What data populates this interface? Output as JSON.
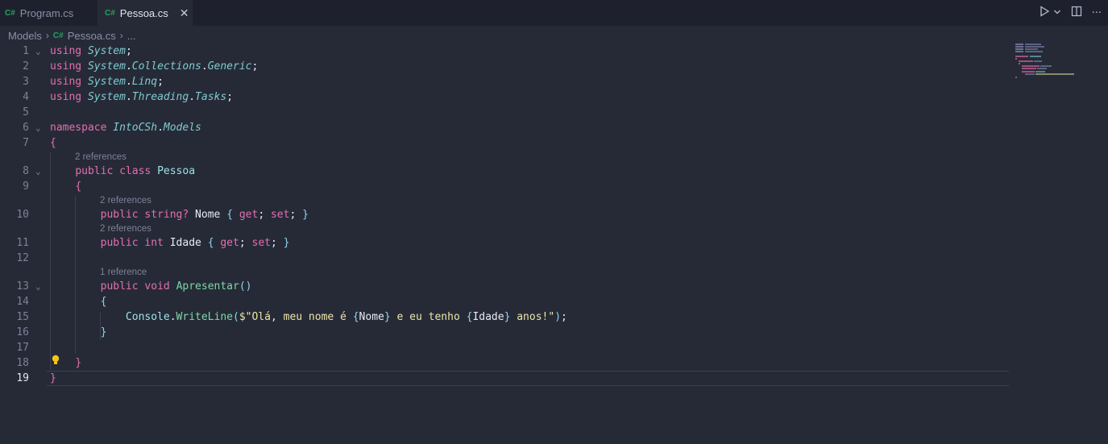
{
  "tabs": [
    {
      "icon": "C#",
      "label": "Program.cs",
      "active": false
    },
    {
      "icon": "C#",
      "label": "Pessoa.cs",
      "active": true
    }
  ],
  "breadcrumb": {
    "folder": "Models",
    "file_icon": "C#",
    "file": "Pessoa.cs",
    "more": "..."
  },
  "editor": {
    "active_line": 19,
    "code_lens": {
      "class_refs": "2 references",
      "nome_refs": "2 references",
      "idade_refs": "2 references",
      "apresentar_refs": "1 reference"
    },
    "lines": [
      {
        "n": "1",
        "tokens": [
          [
            "using ",
            "kw"
          ],
          [
            "System",
            "ns"
          ],
          [
            ";",
            "id"
          ]
        ]
      },
      {
        "n": "2",
        "tokens": [
          [
            "using ",
            "kw"
          ],
          [
            "System",
            "ns"
          ],
          [
            ".",
            "id"
          ],
          [
            "Collections",
            "ns"
          ],
          [
            ".",
            "id"
          ],
          [
            "Generic",
            "ns"
          ],
          [
            ";",
            "id"
          ]
        ]
      },
      {
        "n": "3",
        "tokens": [
          [
            "using ",
            "kw"
          ],
          [
            "System",
            "ns"
          ],
          [
            ".",
            "id"
          ],
          [
            "Linq",
            "ns"
          ],
          [
            ";",
            "id"
          ]
        ]
      },
      {
        "n": "4",
        "tokens": [
          [
            "using ",
            "kw"
          ],
          [
            "System",
            "ns"
          ],
          [
            ".",
            "id"
          ],
          [
            "Threading",
            "ns"
          ],
          [
            ".",
            "id"
          ],
          [
            "Tasks",
            "ns"
          ],
          [
            ";",
            "id"
          ]
        ]
      },
      {
        "n": "5",
        "tokens": []
      },
      {
        "n": "6",
        "tokens": [
          [
            "namespace ",
            "kw"
          ],
          [
            "IntoCSh",
            "ns"
          ],
          [
            ".",
            "id"
          ],
          [
            "Models",
            "ns"
          ]
        ]
      },
      {
        "n": "7",
        "tokens": [
          [
            "{",
            "br"
          ]
        ]
      },
      {
        "n": "8",
        "tokens": [
          [
            "    ",
            "id"
          ],
          [
            "public ",
            "kw"
          ],
          [
            "class ",
            "kw"
          ],
          [
            "Pessoa",
            "cls"
          ]
        ]
      },
      {
        "n": "9",
        "tokens": [
          [
            "    ",
            "id"
          ],
          [
            "{",
            "br"
          ]
        ]
      },
      {
        "n": "10",
        "tokens": [
          [
            "        ",
            "id"
          ],
          [
            "public ",
            "kw"
          ],
          [
            "string",
            "kw"
          ],
          [
            "? ",
            "kw"
          ],
          [
            "Nome ",
            "id"
          ],
          [
            "{ ",
            "br2"
          ],
          [
            "get",
            "kw"
          ],
          [
            "; ",
            "id"
          ],
          [
            "set",
            "kw"
          ],
          [
            "; ",
            "id"
          ],
          [
            "}",
            "br2"
          ]
        ]
      },
      {
        "n": "11",
        "tokens": [
          [
            "        ",
            "id"
          ],
          [
            "public ",
            "kw"
          ],
          [
            "int ",
            "kw"
          ],
          [
            "Idade ",
            "id"
          ],
          [
            "{ ",
            "br2"
          ],
          [
            "get",
            "kw"
          ],
          [
            "; ",
            "id"
          ],
          [
            "set",
            "kw"
          ],
          [
            "; ",
            "id"
          ],
          [
            "}",
            "br2"
          ]
        ]
      },
      {
        "n": "12",
        "tokens": []
      },
      {
        "n": "13",
        "tokens": [
          [
            "        ",
            "id"
          ],
          [
            "public ",
            "kw"
          ],
          [
            "void ",
            "kw"
          ],
          [
            "Apresentar",
            "fn"
          ],
          [
            "()",
            "br2"
          ]
        ]
      },
      {
        "n": "14",
        "tokens": [
          [
            "        ",
            "id"
          ],
          [
            "{",
            "br2"
          ]
        ]
      },
      {
        "n": "15",
        "tokens": [
          [
            "            ",
            "id"
          ],
          [
            "Console",
            "cls"
          ],
          [
            ".",
            "id"
          ],
          [
            "WriteLine",
            "fn"
          ],
          [
            "(",
            "br2"
          ],
          [
            "$\"Olá, meu nome é ",
            "str"
          ],
          [
            "{",
            "br2"
          ],
          [
            "Nome",
            "id"
          ],
          [
            "}",
            "br2"
          ],
          [
            " e eu tenho ",
            "str"
          ],
          [
            "{",
            "br2"
          ],
          [
            "Idade",
            "id"
          ],
          [
            "}",
            "br2"
          ],
          [
            " anos!\"",
            "str"
          ],
          [
            ")",
            "br2"
          ],
          [
            ";",
            "id"
          ]
        ]
      },
      {
        "n": "16",
        "tokens": [
          [
            "        ",
            "id"
          ],
          [
            "}",
            "br2"
          ]
        ]
      },
      {
        "n": "17",
        "tokens": []
      },
      {
        "n": "18",
        "tokens": [
          [
            "    ",
            "id"
          ],
          [
            "}",
            "br"
          ]
        ]
      },
      {
        "n": "19",
        "tokens": [
          [
            "}",
            "br"
          ]
        ]
      }
    ]
  }
}
